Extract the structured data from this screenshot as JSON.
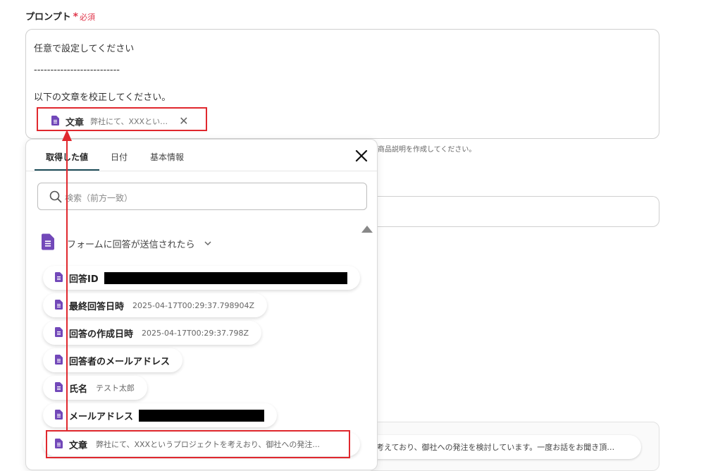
{
  "field": {
    "label": "プロンプト",
    "required_mark": "*",
    "required_text": "必須"
  },
  "prompt": {
    "line1": "任意で設定してください",
    "line2": "--------------------------",
    "line3": "以下の文章を校正してください。",
    "chip": {
      "name": "文章",
      "value": "弊社にて、XXXとい…",
      "close": "✕"
    }
  },
  "background": {
    "helper_text": "商品説明を作成してください。",
    "chip3_text": "考えており、御社への発注を検討しています。一度お話をお聞き頂…"
  },
  "panel": {
    "tabs": [
      {
        "label": "取得した値"
      },
      {
        "label": "日付"
      },
      {
        "label": "基本情報"
      }
    ],
    "search_placeholder": "検索（前方一致）",
    "group": {
      "label": "フォームに回答が送信されたら",
      "chevron": "⌄"
    },
    "items": [
      {
        "name": "回答ID",
        "value": ""
      },
      {
        "name": "最終回答日時",
        "value": "2025-04-17T00:29:37.798904Z"
      },
      {
        "name": "回答の作成日時",
        "value": "2025-04-17T00:29:37.798Z"
      },
      {
        "name": "回答者のメールアドレス",
        "value": ""
      },
      {
        "name": "氏名",
        "value": "テスト太郎"
      },
      {
        "name": "メールアドレス",
        "value": ""
      },
      {
        "name": "文章",
        "value": "弊社にて、XXXというプロジェクトを考えおり、御社への発注..."
      }
    ]
  },
  "colors": {
    "accent_red": "#e0282e",
    "doc_icon_purple": "#7248b9",
    "tab_underline": "#1f4e5a",
    "required_red": "#e0364b"
  },
  "icons": [
    "document-icon",
    "close-icon",
    "search-icon",
    "chevron-down-icon",
    "scroll-up-icon"
  ]
}
